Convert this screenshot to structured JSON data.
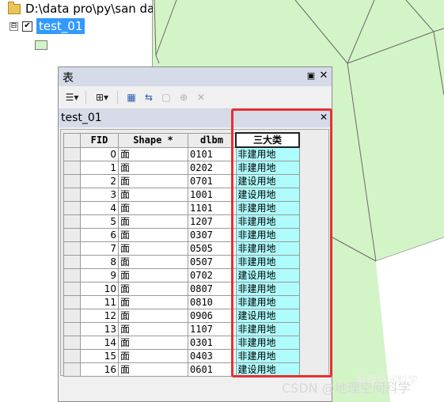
{
  "toc": {
    "path": "D:\\data pro\\py\\san da",
    "expander": "⊟",
    "checkbox": "✔",
    "layer_name": "test_01"
  },
  "table_window": {
    "title": "表",
    "pin": "▣",
    "close": "✕",
    "tab_name": "test_01",
    "tab_close": "✕",
    "toolbar": {
      "options": "☰▾",
      "related": "⊞▾",
      "select_by_attr": "▦",
      "switch_sel": "⇆",
      "clear_sel": "▢",
      "zoom_sel": "⊕",
      "delete": "✕"
    }
  },
  "attribute_table": {
    "columns": [
      "FID",
      "Shape *",
      "dlbm",
      "三大类"
    ],
    "rows": [
      {
        "fid": "0",
        "shape": "面",
        "dlbm": "0101",
        "category": "非建用地"
      },
      {
        "fid": "1",
        "shape": "面",
        "dlbm": "0202",
        "category": "非建用地"
      },
      {
        "fid": "2",
        "shape": "面",
        "dlbm": "0701",
        "category": "建设用地"
      },
      {
        "fid": "3",
        "shape": "面",
        "dlbm": "1001",
        "category": "建设用地"
      },
      {
        "fid": "4",
        "shape": "面",
        "dlbm": "1101",
        "category": "非建用地"
      },
      {
        "fid": "5",
        "shape": "面",
        "dlbm": "1207",
        "category": "非建用地"
      },
      {
        "fid": "6",
        "shape": "面",
        "dlbm": "0307",
        "category": "非建用地"
      },
      {
        "fid": "7",
        "shape": "面",
        "dlbm": "0505",
        "category": "非建用地"
      },
      {
        "fid": "8",
        "shape": "面",
        "dlbm": "0507",
        "category": "非建用地"
      },
      {
        "fid": "9",
        "shape": "面",
        "dlbm": "0702",
        "category": "建设用地"
      },
      {
        "fid": "10",
        "shape": "面",
        "dlbm": "0807",
        "category": "非建用地"
      },
      {
        "fid": "11",
        "shape": "面",
        "dlbm": "0810",
        "category": "非建用地"
      },
      {
        "fid": "12",
        "shape": "面",
        "dlbm": "0906",
        "category": "建设用地"
      },
      {
        "fid": "13",
        "shape": "面",
        "dlbm": "1107",
        "category": "非建用地"
      },
      {
        "fid": "14",
        "shape": "面",
        "dlbm": "0301",
        "category": "非建用地"
      },
      {
        "fid": "15",
        "shape": "面",
        "dlbm": "0403",
        "category": "非建用地"
      },
      {
        "fid": "16",
        "shape": "面",
        "dlbm": "0601",
        "category": "建设用地"
      }
    ]
  },
  "watermark": {
    "text": "CSDN @地理空间科学",
    "ghost": "地理空间科学"
  },
  "colors": {
    "map_fill": "#d3f4c6",
    "selection_blue": "#3399ff",
    "category_cell": "#aefcfc",
    "highlight_box": "#e8302e",
    "panel_header": "#d6dbe9"
  }
}
